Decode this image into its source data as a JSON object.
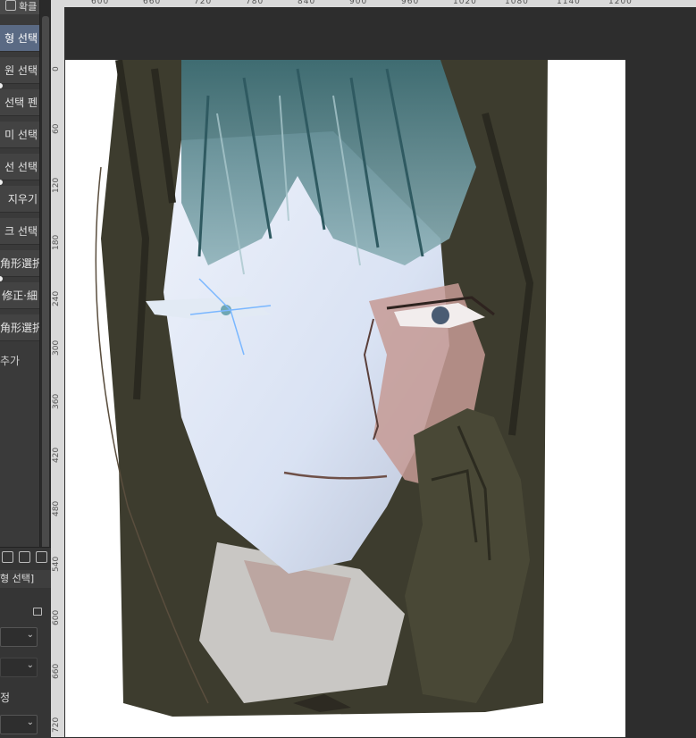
{
  "tool_panel": {
    "top_tab": "확클",
    "sub_tools": [
      {
        "label": "형 선택",
        "active": true
      },
      {
        "label": "원 선택",
        "active": false
      },
      {
        "label": "선택 펜",
        "active": false
      },
      {
        "label": "미 선택",
        "active": false
      },
      {
        "label": "선 선택",
        "active": false
      },
      {
        "label": "지우기",
        "active": false
      },
      {
        "label": "크 선택",
        "active": false
      },
      {
        "label": "角形選択",
        "active": false
      },
      {
        "label": "修正·細",
        "active": false
      },
      {
        "label": "角形選択",
        "active": false
      }
    ],
    "add_sub_tool": "추가",
    "tool_property_title": "형 선택]",
    "correction_label": "정"
  },
  "ruler": {
    "top_labels": [
      "600",
      "660",
      "720",
      "780",
      "840",
      "900",
      "960",
      "1020",
      "1080",
      "1140",
      "1200"
    ],
    "left_labels": [
      "0",
      "60",
      "120",
      "180",
      "240",
      "300",
      "360",
      "420",
      "480",
      "540",
      "600",
      "660",
      "720"
    ]
  },
  "colors": {
    "panel_bg": "#3a3a3a",
    "active_tool": "#5a6a84",
    "canvas_bg": "#2d2d2d",
    "paper": "#ffffff",
    "hair_dark": "#3b3a2c",
    "hair_teal": "#4f7f86",
    "skin_light": "#dfe6f4"
  }
}
